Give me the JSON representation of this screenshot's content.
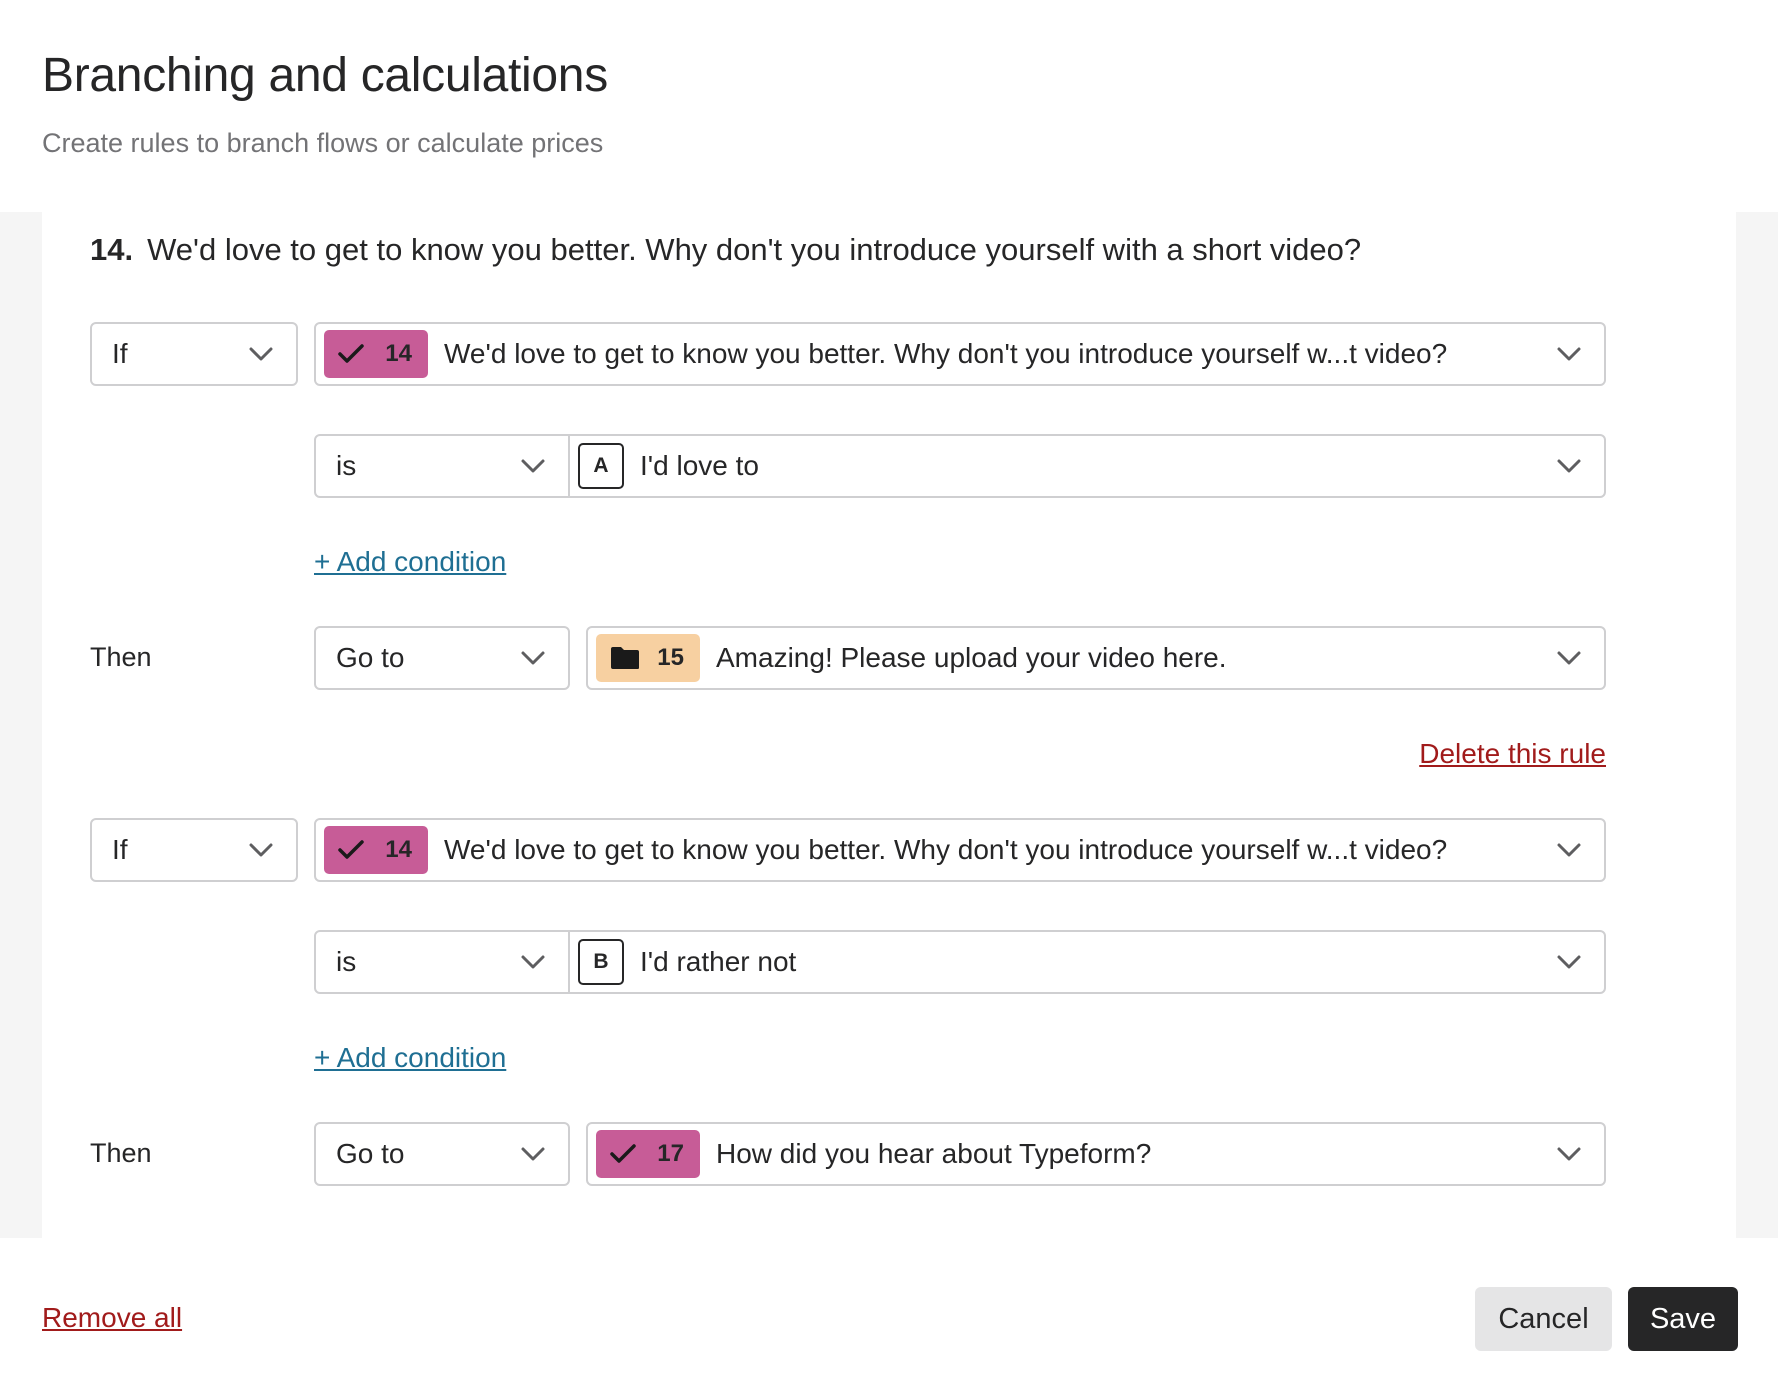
{
  "header": {
    "title": "Branching and calculations",
    "subtitle": "Create rules to branch flows or calculate prices"
  },
  "question": {
    "number": "14.",
    "text": "We'd love to get to know you better. Why don't you introduce yourself with a short video?"
  },
  "rules": [
    {
      "if_label": "If",
      "field_badge": "14",
      "field_icon": "check-icon",
      "field_text": "We'd love to get to know you better. Why don't you introduce yourself w...t video?",
      "operator": "is",
      "value_key": "A",
      "value_text": "I'd love to",
      "add_condition": "+ Add condition",
      "then_label": "Then",
      "action": "Go to",
      "target_badge": "15",
      "target_icon": "folder-icon",
      "target_text": "Amazing! Please upload your video here.",
      "delete_label": "Delete this rule"
    },
    {
      "if_label": "If",
      "field_badge": "14",
      "field_icon": "check-icon",
      "field_text": "We'd love to get to know you better. Why don't you introduce yourself w...t video?",
      "operator": "is",
      "value_key": "B",
      "value_text": "I'd rather not",
      "add_condition": "+ Add condition",
      "then_label": "Then",
      "action": "Go to",
      "target_badge": "17",
      "target_icon": "check-icon",
      "target_text": "How did you hear about Typeform?"
    }
  ],
  "footer": {
    "remove_all": "Remove all",
    "cancel": "Cancel",
    "save": "Save"
  },
  "colors": {
    "badge_pink": "#c75c97",
    "badge_peach": "#f7d0a1",
    "link_blue": "#1f6f93",
    "link_red": "#a11b1b",
    "save_bg": "#262627"
  }
}
